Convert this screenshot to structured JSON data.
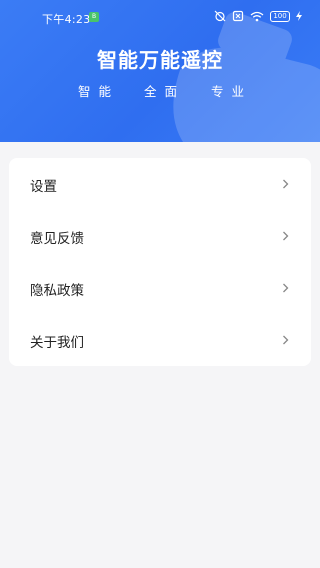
{
  "status_bar": {
    "time": "下午4:23",
    "app_badge": "B",
    "battery": "100"
  },
  "header": {
    "title": "智能万能遥控",
    "taglines": [
      "智能",
      "全面",
      "专业"
    ]
  },
  "menu": {
    "items": [
      {
        "label": "设置"
      },
      {
        "label": "意见反馈"
      },
      {
        "label": "隐私政策"
      },
      {
        "label": "关于我们"
      }
    ]
  },
  "colors": {
    "header_blue": "#3478f6",
    "background": "#f5f5f7",
    "card": "#ffffff"
  }
}
